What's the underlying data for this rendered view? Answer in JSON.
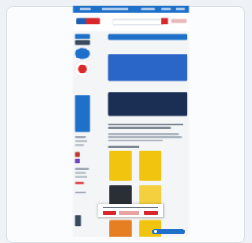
{
  "page": {
    "title": "",
    "text_legible": false
  },
  "colors": {
    "topbar": "#1f70c9",
    "brand_blue": "#1e5fb4",
    "brand_red": "#d8282c",
    "page_bg": "#eef2f6",
    "card_bg": "#fbfcfd"
  },
  "icons": [
    "globe-icon",
    "percent-badge-icon",
    "chat-icon",
    "search-icon",
    "cart-icon"
  ]
}
